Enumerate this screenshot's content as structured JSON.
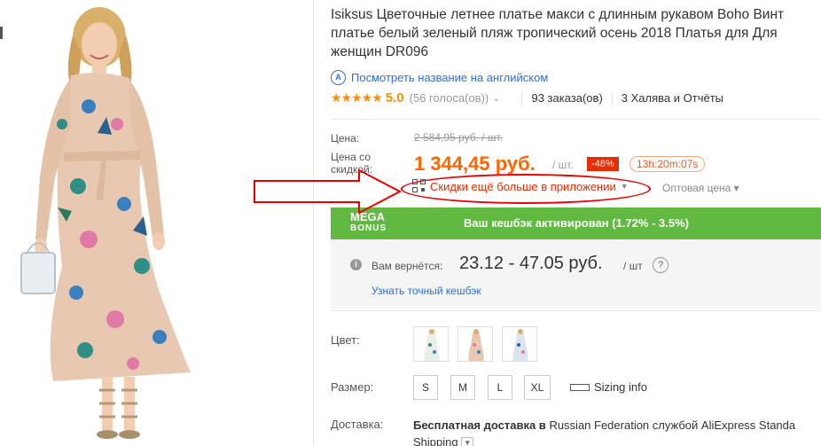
{
  "product": {
    "title_line1": "Isiksus Цветочные летнее платье макси с длинным рукавом Boho Винт",
    "title_line2": "платье белый зеленый пляж тропический осень 2018 Платья для Для",
    "title_line3": "женщин DR096",
    "translate_link": "Посмотреть название на английском",
    "translate_icon_text": "A"
  },
  "rating": {
    "stars": "★★★★★",
    "value": "5.0",
    "votes": "(56 голоса(ов))",
    "orders": "93 заказа(ов)",
    "reviews": "3 Халява и Отчёты"
  },
  "price": {
    "label": "Цена:",
    "old": "2 584,95 руб. / шт.",
    "discount_label_1": "Цена со",
    "discount_label_2": "скидкой:",
    "new": "1 344,45 руб.",
    "per_unit": "/ шт.",
    "discount_badge": "-48%",
    "timer": "13h:20m:07s",
    "app_discount": "Скидки ещё больше в приложении",
    "wholesale": "Оптовая цена ▾"
  },
  "bonus": {
    "mega": "MEGA",
    "bonus": "BONUS",
    "text": "Ваш кешбэк активирован (1.72% - 3.5%)"
  },
  "cashback": {
    "label": "Вам вернётся:",
    "amount": "23.12 - 47.05 руб.",
    "per": "/ шт",
    "help": "?",
    "link": "Узнать точный кешбэк"
  },
  "options": {
    "color_label": "Цвет:",
    "size_label": "Размер:",
    "sizes": [
      "S",
      "M",
      "L",
      "XL"
    ],
    "sizing_info": "Sizing info"
  },
  "shipping": {
    "label": "Доставка:",
    "bold": "Бесплатная доставка в",
    "text": "Russian Federation службой AliExpress Standa",
    "text2": "Shipping"
  },
  "colors": {
    "price": "#ff6600",
    "badge": "#e62e04",
    "link": "#2e6fd9",
    "bonus_bar": "#62b942",
    "annotation": "#e00000"
  }
}
